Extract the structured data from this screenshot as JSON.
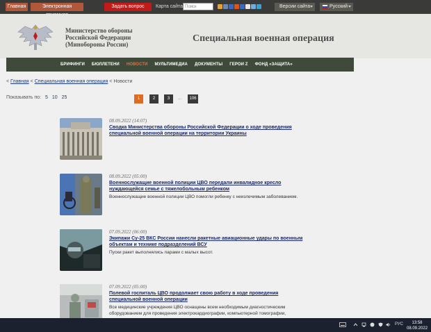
{
  "topbar": {
    "main_btn": "Главная",
    "reception_btn": "Электронная приемная",
    "ask_btn": "Задать вопрос",
    "sitemap": "Карта сайта",
    "search_placeholder": "Поиск",
    "version": "Версии сайта",
    "language": "Русский",
    "social_colors": [
      "#e8a030",
      "#6a8ab8",
      "#3a6ac0",
      "#e05020",
      "#3a6ac0",
      "#e8e8e8",
      "#6ab0e0",
      "#3aa0d0"
    ]
  },
  "header": {
    "org_line1": "Министерство обороны",
    "org_line2": "Российской Федерации",
    "org_line3": "(Минобороны России)",
    "project_title": "Специальная военная операция"
  },
  "nav": [
    "БРИФИНГИ",
    "БЮЛЛЕТЕНИ",
    "НОВОСТИ",
    "МУЛЬТИМЕДИА",
    "ДОКУМЕНТЫ",
    "ГЕРОИ Z",
    "ФОНД «ЗАЩИТА»"
  ],
  "breadcrumb": {
    "prefix": "< ",
    "home": "Главная",
    "sep1": " < ",
    "section": "Специальная военная операция",
    "sep2": " < ",
    "current": "Новости"
  },
  "paging": {
    "show_label": "Показывать по:",
    "per_page": [
      "5",
      "10",
      "25"
    ],
    "pages": [
      "1",
      "2",
      "3"
    ],
    "ellipsis": "...",
    "last": "106"
  },
  "news": [
    {
      "date": "08.09.2022 (14:07)",
      "title": "Сводка Министерства обороны Российской Федерации о ходе проведения специальной военной операции на территории Украины",
      "desc": ""
    },
    {
      "date": "08.09.2022 (05:00)",
      "title": "Военнослужащие военной полиции ЦВО передали инвалидное кресло нуждающейся семье с тяжелобольным ребенком",
      "desc": "Военнослужащие военной полиции ЦВО помогли ребенку с неизлечимым заболеванием."
    },
    {
      "date": "07.09.2022 (06:00)",
      "title": "Экипажи Су-25 ВКС России нанесли ракетные авиационные удары по военным объектам и технике подразделений ВСУ",
      "desc": "Пуски ракет выполнялись парами с малых высот."
    },
    {
      "date": "07.09.2022 (05:00)",
      "title": "Полевой госпиталь ЦВО продолжает свою работу в ходе проведения специальной военной операции",
      "desc": "Все медицинские учреждения ЦВО оснащены всем необходимым диагностическим оборудованием для проведения электрокардиографии, компьютерной томографии,"
    }
  ],
  "taskbar": {
    "lang": "РУС",
    "time": "13:58",
    "date": "08.09.2022"
  }
}
